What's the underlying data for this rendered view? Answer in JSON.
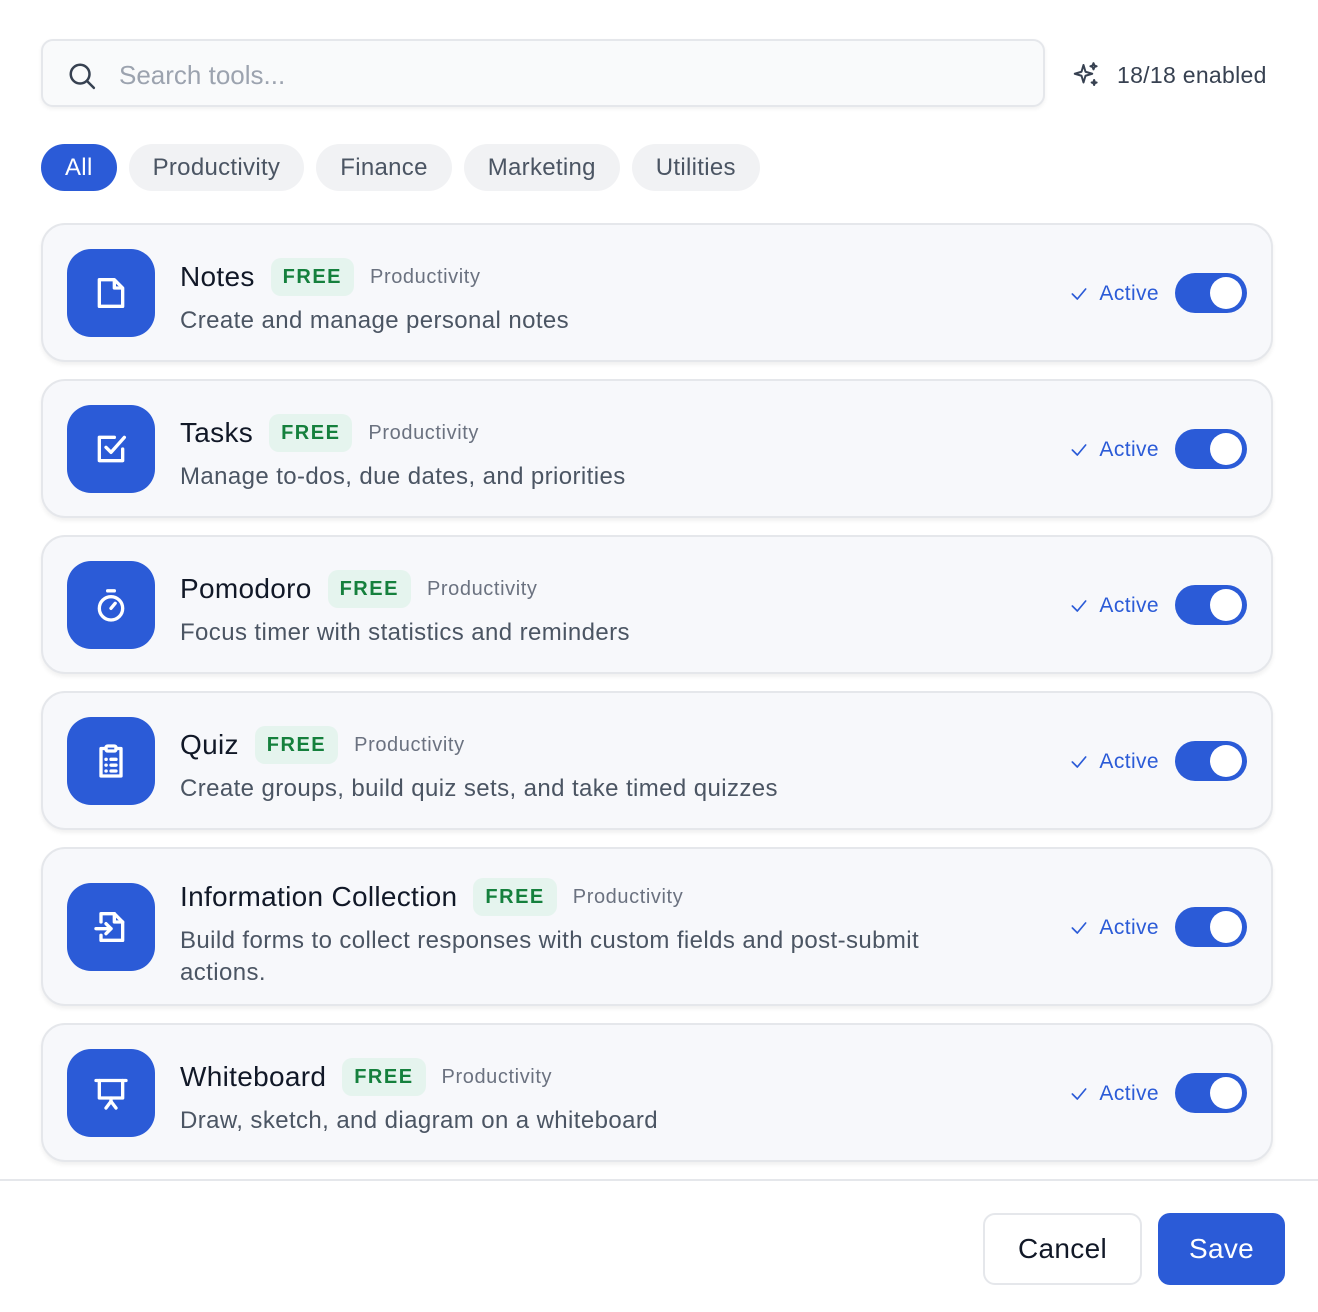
{
  "search": {
    "placeholder": "Search tools...",
    "value": ""
  },
  "enabled_status": "18/18 enabled",
  "filters": [
    {
      "label": "All",
      "active": true
    },
    {
      "label": "Productivity",
      "active": false
    },
    {
      "label": "Finance",
      "active": false
    },
    {
      "label": "Marketing",
      "active": false
    },
    {
      "label": "Utilities",
      "active": false
    }
  ],
  "tools": [
    {
      "name": "Notes",
      "badge": "FREE",
      "category": "Productivity",
      "description": "Create and manage personal notes",
      "icon": "note-icon",
      "status": "Active",
      "enabled": true
    },
    {
      "name": "Tasks",
      "badge": "FREE",
      "category": "Productivity",
      "description": "Manage to-dos, due dates, and priorities",
      "icon": "checkbox-icon",
      "status": "Active",
      "enabled": true
    },
    {
      "name": "Pomodoro",
      "badge": "FREE",
      "category": "Productivity",
      "description": "Focus timer with statistics and reminders",
      "icon": "timer-icon",
      "status": "Active",
      "enabled": true
    },
    {
      "name": "Quiz",
      "badge": "FREE",
      "category": "Productivity",
      "description": "Create groups, build quiz sets, and take timed quizzes",
      "icon": "clipboard-list-icon",
      "status": "Active",
      "enabled": true
    },
    {
      "name": "Information Collection",
      "badge": "FREE",
      "category": "Productivity",
      "description": "Build forms to collect responses with custom fields and post-submit actions.",
      "icon": "file-import-icon",
      "status": "Active",
      "enabled": true
    },
    {
      "name": "Whiteboard",
      "badge": "FREE",
      "category": "Productivity",
      "description": "Draw, sketch, and diagram on a whiteboard",
      "icon": "presentation-icon",
      "status": "Active",
      "enabled": true
    }
  ],
  "footer": {
    "cancel_label": "Cancel",
    "save_label": "Save"
  },
  "colors": {
    "accent": "#2b5bd7",
    "badge_bg": "#e5f4ee",
    "badge_text": "#15803d"
  }
}
